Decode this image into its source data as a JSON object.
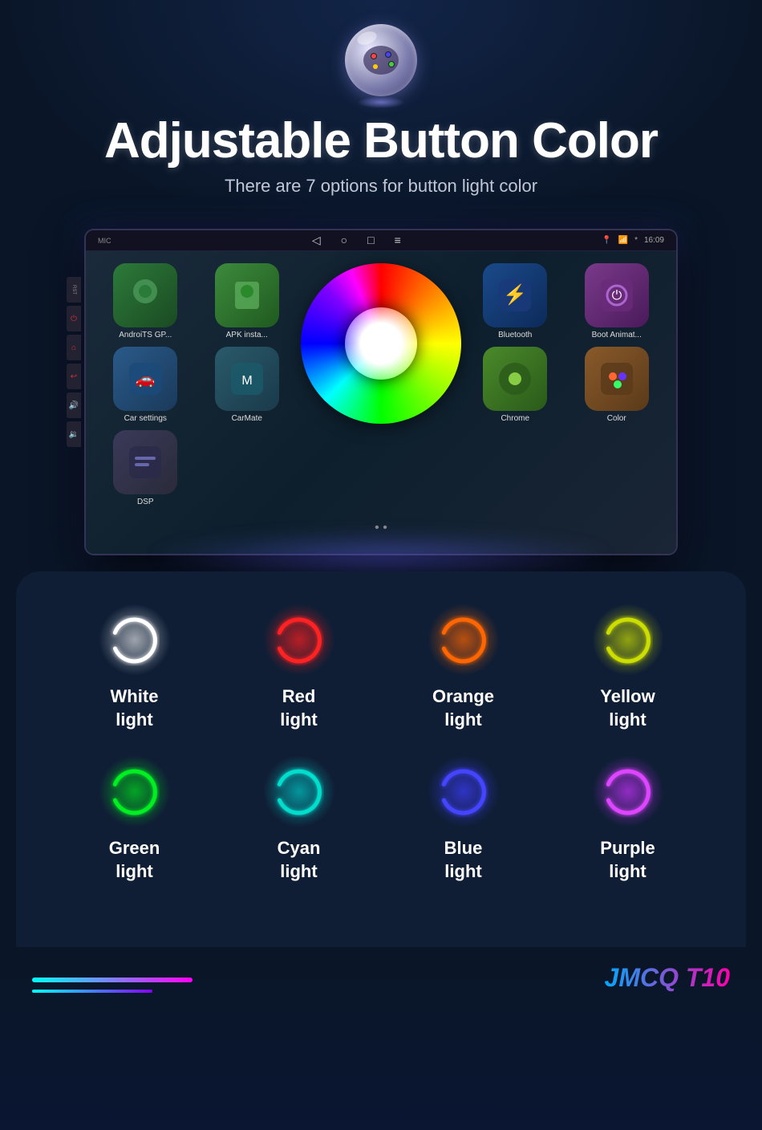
{
  "header": {
    "title": "Adjustable Button Color",
    "subtitle": "There are 7 options for button light color"
  },
  "device": {
    "mic_label": "MIC",
    "rst_label": "RST",
    "time": "16:09",
    "apps": [
      {
        "name": "AndroiTS GP...",
        "class": "app-androits"
      },
      {
        "name": "APK insta...",
        "class": "app-apk"
      },
      {
        "name": "Bluetooth",
        "class": "app-bluetooth"
      },
      {
        "name": "Boot Animat...",
        "class": "app-boot"
      },
      {
        "name": "Car settings",
        "class": "app-carsettings"
      },
      {
        "name": "CarMate",
        "class": "app-carmate"
      },
      {
        "name": "Chrome",
        "class": "app-chrome"
      },
      {
        "name": "Color",
        "class": "app-color"
      },
      {
        "name": "DSP",
        "class": "app-dsp"
      }
    ]
  },
  "lights": [
    {
      "label": "White\nlight",
      "label_line1": "White",
      "label_line2": "light",
      "color": "#ffffff",
      "glow": "rgba(255,255,255,0.6)"
    },
    {
      "label": "Red\nlight",
      "label_line1": "Red",
      "label_line2": "light",
      "color": "#ff2020",
      "glow": "rgba(255,30,30,0.7)"
    },
    {
      "label": "Orange\nlight",
      "label_line1": "Orange",
      "label_line2": "light",
      "color": "#ff6600",
      "glow": "rgba(255,100,0,0.7)"
    },
    {
      "label": "Yellow\nlight",
      "label_line1": "Yellow",
      "label_line2": "light",
      "color": "#ccdd00",
      "glow": "rgba(200,220,0,0.7)"
    },
    {
      "label": "Green\nlight",
      "label_line1": "Green",
      "label_line2": "light",
      "color": "#00ee22",
      "glow": "rgba(0,220,30,0.7)"
    },
    {
      "label": "Cyan\nlight",
      "label_line1": "Cyan",
      "label_line2": "light",
      "color": "#00ddcc",
      "glow": "rgba(0,200,200,0.7)"
    },
    {
      "label": "Blue\nlight",
      "label_line1": "Blue",
      "label_line2": "light",
      "color": "#4444ff",
      "glow": "rgba(60,60,255,0.7)"
    },
    {
      "label": "Purple\nlight",
      "label_line1": "Purple",
      "label_line2": "light",
      "color": "#dd44ff",
      "glow": "rgba(200,50,255,0.7)"
    }
  ],
  "brand": {
    "name": "JMCQ T10"
  }
}
